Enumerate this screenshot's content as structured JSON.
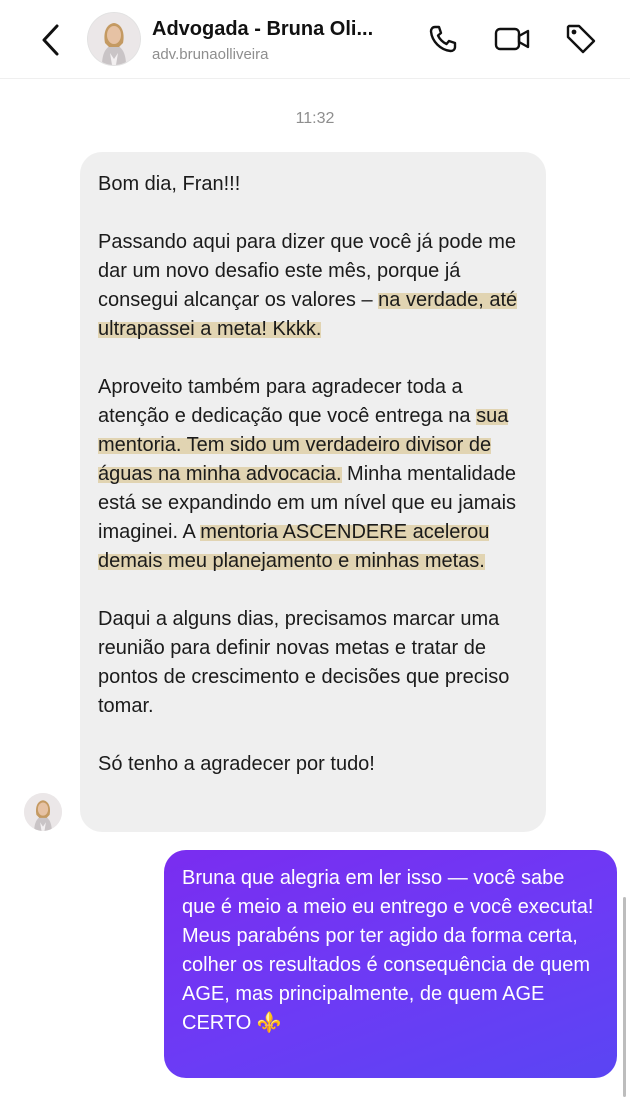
{
  "header": {
    "title": "Advogada - Bruna Oli...",
    "username": "adv.brunaolliveira"
  },
  "thread": {
    "timestamp": "11:32"
  },
  "incoming_message": {
    "p1": "Bom dia, Fran!!!",
    "p2_a": "Passando aqui para dizer que você já pode me dar um novo desafio este mês, porque já consegui alcançar os valores – ",
    "p2_hl": "na verdade, até ultrapassei a meta! Kkkk.",
    "p3_a": "Aproveito também para agradecer toda a atenção e dedicação que você entrega na ",
    "p3_hl1": "sua mentoria. Tem sido um verdadeiro divisor de águas na minha advocacia.",
    "p3_b": " Minha mentalidade está se expandindo em um nível que eu jamais imaginei. A ",
    "p3_hl2": "mentoria ASCENDERE acelerou demais meu planejamento e minhas metas.",
    "p4": "Daqui a alguns dias, precisamos marcar uma reunião para definir novas metas e tratar de pontos de crescimento e decisões que preciso tomar.",
    "p5": "Só tenho a agradecer por tudo!"
  },
  "outgoing_message": {
    "text": "Bruna que alegria em ler isso — você sabe que é meio a meio eu entrego e você executa! Meus parabéns por ter agido da forma certa, colher os resultados é consequência de quem AGE, mas principalmente, de quem AGE CERTO ⚜️"
  },
  "colors": {
    "incoming_bubble": "#efefef",
    "outgoing_bubble": "#6c3bf5",
    "highlight": "#d6be80"
  },
  "icons": {
    "back": "chevron-left-icon",
    "call": "phone-icon",
    "video": "video-camera-icon",
    "tag": "tag-icon"
  }
}
